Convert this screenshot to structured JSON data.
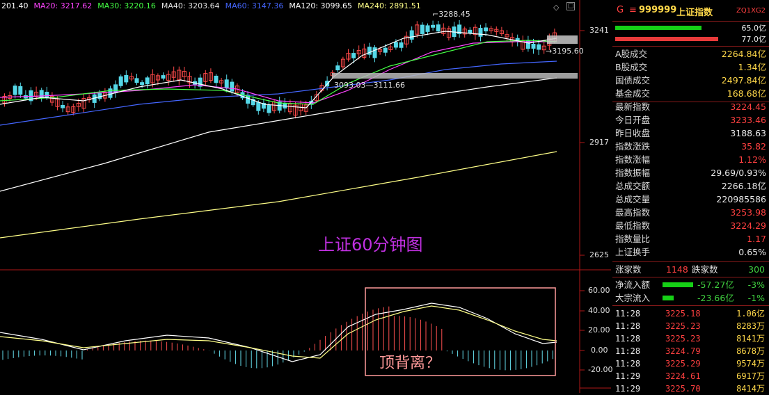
{
  "ma_legend": [
    {
      "text": "201.40",
      "color": "#ffffff"
    },
    {
      "text": "MA20: 3217.62",
      "color": "#ff44ff"
    },
    {
      "text": "MA30: 3220.16",
      "color": "#44ff44"
    },
    {
      "text": "MA40: 3203.64",
      "color": "#e0e0e0"
    },
    {
      "text": "MA60: 3147.36",
      "color": "#4466ff"
    },
    {
      "text": "MA120: 3099.65",
      "color": "#ffffff"
    },
    {
      "text": "MA240: 2891.51",
      "color": "#ffff88"
    }
  ],
  "price_axis": [
    "3241",
    "2917",
    "2625"
  ],
  "macd_axis": [
    "60.00",
    "40.00",
    "20.00",
    "0.00",
    "-20.00"
  ],
  "annotations": {
    "high": "3288.45",
    "right_low": "3195.60",
    "left_zone": "3093.03",
    "left_zone2": "3111.66",
    "title": "上证60分钟图",
    "divergence": "顶背离？"
  },
  "header": {
    "code_prefix": "G",
    "menu_glyph": "≡",
    "code": "999999",
    "name": "上证指数",
    "tag": "ZQ1XG2",
    "bar_up_value": "65.0亿",
    "bar_down_value": "77.0亿"
  },
  "stats": [
    {
      "label": "A股成交",
      "value": "2264.84亿",
      "color": "yellow"
    },
    {
      "label": "B股成交",
      "value": "1.34亿",
      "color": "yellow"
    },
    {
      "label": "国债成交",
      "value": "2497.84亿",
      "color": "yellow"
    },
    {
      "label": "基金成交",
      "value": "168.68亿",
      "color": "yellow"
    },
    {
      "label": "最新指数",
      "value": "3224.45",
      "color": "red"
    },
    {
      "label": "今日开盘",
      "value": "3233.46",
      "color": "red"
    },
    {
      "label": "昨日收盘",
      "value": "3188.63",
      "color": "white"
    },
    {
      "label": "指数涨跌",
      "value": "35.82",
      "color": "red"
    },
    {
      "label": "指数涨幅",
      "value": "1.12%",
      "color": "red"
    },
    {
      "label": "指数振幅",
      "value": "29.69/0.93%",
      "color": "white"
    },
    {
      "label": "总成交额",
      "value": "2266.18亿",
      "color": "white"
    },
    {
      "label": "总成交量",
      "value": "220985586",
      "color": "white"
    },
    {
      "label": "最高指数",
      "value": "3253.98",
      "color": "red"
    },
    {
      "label": "最低指数",
      "value": "3224.29",
      "color": "red"
    },
    {
      "label": "指数量比",
      "value": "1.17",
      "color": "red"
    },
    {
      "label": "上证换手",
      "value": "0.65%",
      "color": "white"
    }
  ],
  "advance": {
    "up_label": "涨家数",
    "up": "1148",
    "down_label": "跌家数",
    "down": "300"
  },
  "flows": [
    {
      "label": "净流入额",
      "value": "-57.27亿",
      "pct": "-3%"
    },
    {
      "label": "大宗流入",
      "value": "-23.66亿",
      "pct": "-1%"
    }
  ],
  "ticks": [
    {
      "time": "11:28",
      "price": "3225.18",
      "vol": "1.06亿"
    },
    {
      "time": "11:28",
      "price": "3225.23",
      "vol": "8283万"
    },
    {
      "time": "11:28",
      "price": "3225.23",
      "vol": "8141万"
    },
    {
      "time": "11:28",
      "price": "3224.79",
      "vol": "8678万"
    },
    {
      "time": "11:28",
      "price": "3225.29",
      "vol": "9574万"
    },
    {
      "time": "11:29",
      "price": "3224.61",
      "vol": "6917万"
    },
    {
      "time": "11:29",
      "price": "3225.70",
      "vol": "8414万"
    }
  ]
}
